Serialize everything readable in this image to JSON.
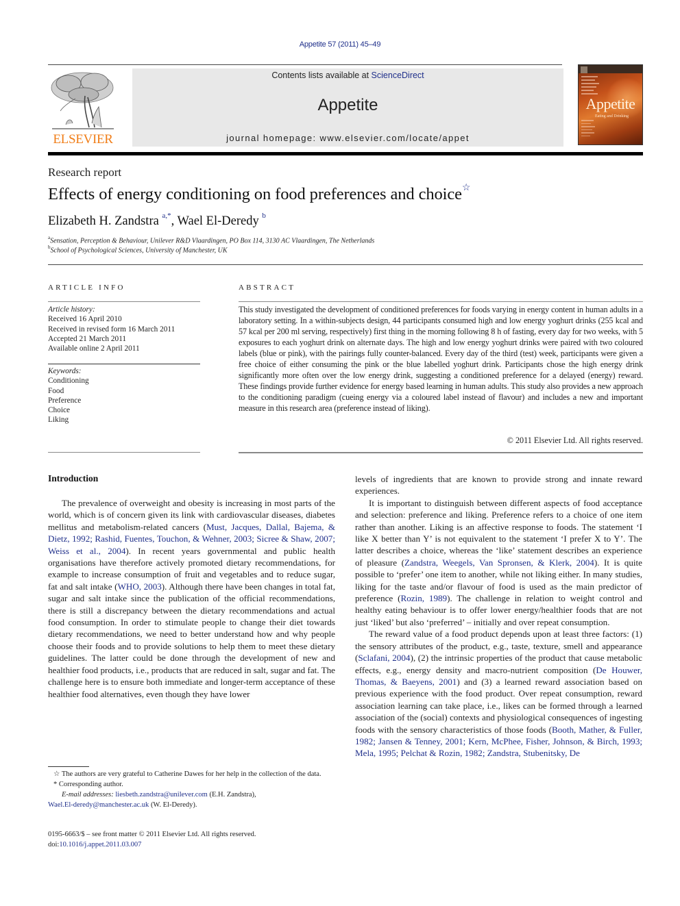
{
  "journal_ref": "Appetite 57 (2011) 45–49",
  "publisher": {
    "logo_text": "ELSEVIER",
    "logo_color": "#f07d17"
  },
  "banner": {
    "contents_prefix": "Contents lists available at ",
    "contents_link": "ScienceDirect",
    "journal_title": "Appetite",
    "homepage": "journal homepage: www.elsevier.com/locate/appet"
  },
  "cover": {
    "title": "Appetite",
    "subtitle": "Eating and Drinking"
  },
  "article": {
    "type": "Research report",
    "title": "Effects of energy conditioning on food preferences and choice",
    "title_mark": "☆",
    "authors": [
      {
        "name": "Elizabeth H. Zandstra",
        "sup": "a,*"
      },
      {
        "name": "Wael El-Deredy",
        "sup": "b"
      }
    ],
    "author_separator": ", ",
    "affiliations": [
      {
        "mark": "a",
        "text": "Sensation, Perception & Behaviour, Unilever R&D Vlaardingen, PO Box 114, 3130 AC Vlaardingen, The Netherlands"
      },
      {
        "mark": "b",
        "text": "School of Psychological Sciences, University of Manchester, UK"
      }
    ]
  },
  "article_info": {
    "heading": "ARTICLE INFO",
    "history_label": "Article history:",
    "history": [
      "Received 16 April 2010",
      "Received in revised form 16 March 2011",
      "Accepted 21 March 2011",
      "Available online 2 April 2011"
    ],
    "keywords_label": "Keywords:",
    "keywords": [
      "Conditioning",
      "Food",
      "Preference",
      "Choice",
      "Liking"
    ]
  },
  "abstract": {
    "heading": "ABSTRACT",
    "text": "This study investigated the development of conditioned preferences for foods varying in energy content in human adults in a laboratory setting. In a within-subjects design, 44 participants consumed high and low energy yoghurt drinks (255 kcal and 57 kcal per 200 ml serving, respectively) first thing in the morning following 8 h of fasting, every day for two weeks, with 5 exposures to each yoghurt drink on alternate days. The high and low energy yoghurt drinks were paired with two coloured labels (blue or pink), with the pairings fully counter-balanced. Every day of the third (test) week, participants were given a free choice of either consuming the pink or the blue labelled yoghurt drink. Participants chose the high energy drink significantly more often over the low energy drink, suggesting a conditioned preference for a delayed (energy) reward. These findings provide further evidence for energy based learning in human adults. This study also provides a new approach to the conditioning paradigm (cueing energy via a coloured label instead of flavour) and includes a new and important measure in this research area (preference instead of liking).",
    "copyright": "© 2011 Elsevier Ltd. All rights reserved."
  },
  "body": {
    "intro_heading": "Introduction",
    "left_p1": [
      {
        "t": "The prevalence of overweight and obesity is increasing in most parts of the world, which is of concern given its link with cardiovascular diseases, diabetes mellitus and metabolism-related cancers ("
      },
      {
        "t": "Must, Jacques, Dallal, Bajema, & Dietz, 1992; Rashid, Fuentes, Touchon, & Wehner, 2003; Sicree & Shaw, 2007; Weiss et al., 2004",
        "link": true
      },
      {
        "t": "). In recent years governmental and public health organisations have therefore actively promoted dietary recommendations, for example to increase consumption of fruit and vegetables and to reduce sugar, fat and salt intake ("
      },
      {
        "t": "WHO, 2003",
        "link": true
      },
      {
        "t": "). Although there have been changes in total fat, sugar and salt intake since the publication of the official recommendations, there is still a discrepancy between the dietary recommendations and actual food consumption. In order to stimulate people to change their diet towards dietary recommendations, we need to better understand how and why people choose their foods and to provide solutions to help them to meet these dietary guidelines. The latter could be done through the development of new and healthier food products, i.e., products that are reduced in salt, sugar and fat. The challenge here is to ensure both immediate and longer-term acceptance of these healthier food alternatives, even though they have lower"
      }
    ],
    "right_p0": "levels of ingredients that are known to provide strong and innate reward experiences.",
    "right_p1": [
      {
        "t": "It is important to distinguish between different aspects of food acceptance and selection: preference and liking. Preference refers to a choice of one item rather than another. Liking is an affective response to foods. The statement ‘I like X better than Y’ is not equivalent to the statement ‘I prefer X to Y’. The latter describes a choice, whereas the ‘like’ statement describes an experience of pleasure ("
      },
      {
        "t": "Zandstra, Weegels, Van Spronsen, & Klerk, 2004",
        "link": true
      },
      {
        "t": "). It is quite possible to ‘prefer’ one item to another, while not liking either. In many studies, liking for the taste and/or flavour of food is used as the main predictor of preference ("
      },
      {
        "t": "Rozin, 1989",
        "link": true
      },
      {
        "t": "). The challenge in relation to weight control and healthy eating behaviour is to offer lower energy/healthier foods that are not just ‘liked’ but also ‘preferred’ – initially and over repeat consumption."
      }
    ],
    "right_p2": [
      {
        "t": "The reward value of a food product depends upon at least three factors: (1) the sensory attributes of the product, e.g., taste, texture, smell and appearance ("
      },
      {
        "t": "Sclafani, 2004",
        "link": true
      },
      {
        "t": "), (2) the intrinsic properties of the product that cause metabolic effects, e.g., energy density and macro-nutrient composition ("
      },
      {
        "t": "De Houwer, Thomas, & Baeyens, 2001",
        "link": true
      },
      {
        "t": ") and (3) a learned reward association based on previous experience with the food product. Over repeat consumption, reward association learning can take place, i.e., likes can be formed through a learned association of the (social) contexts and physiological consequences of ingesting foods with the sensory characteristics of those foods ("
      },
      {
        "t": "Booth, Mather, & Fuller, 1982; Jansen & Tenney, 2001; Kern, McPhee, Fisher, Johnson, & Birch, 1993; Mela, 1995; Pelchat & Rozin, 1982; Zandstra, Stubenitsky, De",
        "link": true
      }
    ]
  },
  "footnotes": {
    "star_mark": "☆",
    "star_text": "The authors are very grateful to Catherine Dawes for her help in the collection of the data.",
    "corr_mark": "*",
    "corr_text": "Corresponding author.",
    "email_label": "E-mail addresses:",
    "email1": "liesbeth.zandstra@unilever.com",
    "email1_owner": " (E.H. Zandstra),",
    "email2": "Wael.El-deredy@manchester.ac.uk",
    "email2_owner": " (W. El-Deredy).",
    "issn": "0195-6663/$ – see front matter © 2011 Elsevier Ltd. All rights reserved.",
    "doi_prefix": "doi:",
    "doi": "10.1016/j.appet.2011.03.007"
  },
  "colors": {
    "link": "#1f2f8a",
    "banner_bg": "#e8e8e8",
    "elsevier_orange": "#f07d17"
  }
}
